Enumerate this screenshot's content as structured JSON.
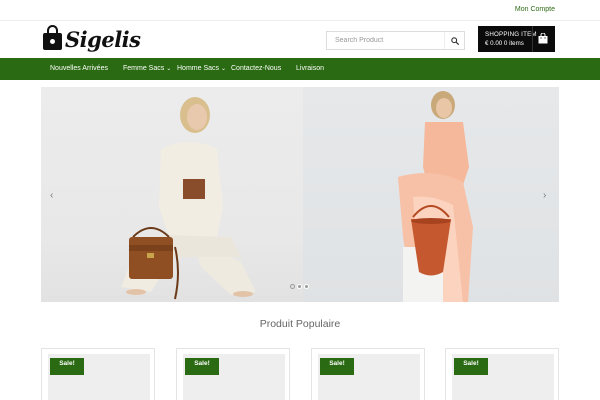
{
  "topbar": {
    "account_label": "Mon Compte"
  },
  "header": {
    "logo_text": "Sigelis",
    "search": {
      "placeholder": "Search Product",
      "value": ""
    },
    "cart": {
      "title": "SHOPPING ITEM",
      "amount": "€ 0.00 0 items"
    }
  },
  "nav": {
    "items": [
      {
        "label": "Nouvelles Arrivées",
        "has_dropdown": false
      },
      {
        "label": "Femme Sacs",
        "has_dropdown": true
      },
      {
        "label": "Homme Sacs",
        "has_dropdown": true
      },
      {
        "label": "Contactez-Nous",
        "has_dropdown": false
      },
      {
        "label": "Livraison",
        "has_dropdown": false
      }
    ],
    "chevron": "⌄"
  },
  "slider": {
    "prev_glyph": "‹",
    "next_glyph": "›",
    "active_slide": 2,
    "slide_count": 3
  },
  "popular": {
    "title": "Produit Populaire",
    "products": [
      {
        "badge": "Sale!"
      },
      {
        "badge": "Sale!"
      },
      {
        "badge": "Sale!"
      },
      {
        "badge": "Sale!"
      }
    ]
  },
  "colors": {
    "brand_green": "#2a6a12",
    "link_green": "#2f6b16",
    "cart_black": "#0b0b0b"
  },
  "icons": {
    "search": "search-icon",
    "cart": "shopping-bag-icon",
    "logo": "handbag-logo-icon"
  }
}
